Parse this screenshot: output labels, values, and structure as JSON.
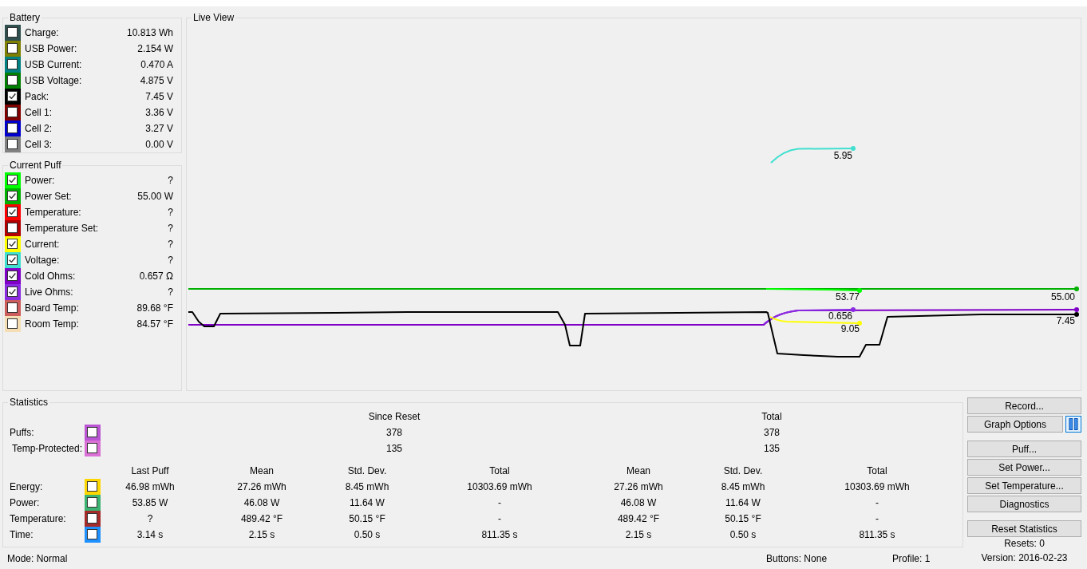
{
  "battery": {
    "title": "Battery",
    "rows": [
      {
        "label": "Charge:",
        "value": "10.813 Wh",
        "color": "#2f4f4f",
        "checked": false
      },
      {
        "label": "USB Power:",
        "value": "2.154 W",
        "color": "#808000",
        "checked": false
      },
      {
        "label": "USB Current:",
        "value": "0.470 A",
        "color": "#008080",
        "checked": false
      },
      {
        "label": "USB Voltage:",
        "value": "4.875 V",
        "color": "#008000",
        "checked": false
      },
      {
        "label": "Pack:",
        "value": "7.45 V",
        "color": "#000000",
        "checked": true
      },
      {
        "label": "Cell 1:",
        "value": "3.36 V",
        "color": "#800000",
        "checked": false
      },
      {
        "label": "Cell 2:",
        "value": "3.27 V",
        "color": "#0000cd",
        "checked": false
      },
      {
        "label": "Cell 3:",
        "value": "0.00 V",
        "color": "#808080",
        "checked": false
      }
    ]
  },
  "current_puff": {
    "title": "Current Puff",
    "rows": [
      {
        "label": "Power:",
        "value": "?",
        "color": "#00ff00",
        "checked": true
      },
      {
        "label": "Power Set:",
        "value": "55.00 W",
        "color": "#00b000",
        "checked": true
      },
      {
        "label": "Temperature:",
        "value": "?",
        "color": "#ff0000",
        "checked": true
      },
      {
        "label": "Temperature Set:",
        "value": "?",
        "color": "#b00000",
        "checked": false
      },
      {
        "label": "Current:",
        "value": "?",
        "color": "#ffff00",
        "checked": true
      },
      {
        "label": "Voltage:",
        "value": "?",
        "color": "#40e0d0",
        "checked": true
      },
      {
        "label": "Cold Ohms:",
        "value": "0.657 Ω",
        "color": "#8000c8",
        "checked": true
      },
      {
        "label": "Live Ohms:",
        "value": "?",
        "color": "#8a2be2",
        "checked": true
      },
      {
        "label": "Board Temp:",
        "value": "89.68 °F",
        "color": "#cd5c5c",
        "checked": false
      },
      {
        "label": "Room Temp:",
        "value": "84.57 °F",
        "color": "#f5deb3",
        "checked": false
      }
    ]
  },
  "live_view": {
    "title": "Live View",
    "traces": [
      {
        "color": "#40e0d0",
        "label": "5.95"
      },
      {
        "color": "#00ff00",
        "label": "53.77"
      },
      {
        "color": "#00b000",
        "label": "55.00"
      },
      {
        "color": "#8a2be2",
        "label": "0.656"
      },
      {
        "color": "#8000c8"
      },
      {
        "color": "#000000",
        "label": "7.45"
      },
      {
        "color": "#ffff00",
        "label": "9.05"
      }
    ]
  },
  "statistics": {
    "title": "Statistics",
    "count_columns": [
      "Since Reset",
      "Total"
    ],
    "count_rows": [
      {
        "label": "Puffs:",
        "color": "#ba55d3",
        "checked": false,
        "values": [
          "378",
          "378"
        ]
      },
      {
        "label": "Temp-Protected:",
        "color": "#da70d6",
        "checked": false,
        "values": [
          "135",
          "135"
        ]
      }
    ],
    "columns": [
      "Last Puff",
      "Mean",
      "Std. Dev.",
      "Total",
      "Mean",
      "Std. Dev.",
      "Total"
    ],
    "rows": [
      {
        "label": "Energy:",
        "color": "#ffd700",
        "checked": false,
        "values": [
          "46.98 mWh",
          "27.26 mWh",
          "8.45 mWh",
          "10303.69 mWh",
          "27.26 mWh",
          "8.45 mWh",
          "10303.69 mWh"
        ]
      },
      {
        "label": "Power:",
        "color": "#3cb371",
        "checked": false,
        "values": [
          "53.85 W",
          "46.08 W",
          "11.64 W",
          "-",
          "46.08 W",
          "11.64 W",
          "-"
        ]
      },
      {
        "label": "Temperature:",
        "color": "#a52a2a",
        "checked": false,
        "values": [
          "?",
          "489.42 °F",
          "50.15 °F",
          "-",
          "489.42 °F",
          "50.15 °F",
          "-"
        ]
      },
      {
        "label": "Time:",
        "color": "#1e90ff",
        "checked": false,
        "values": [
          "3.14 s",
          "2.15 s",
          "0.50 s",
          "811.35 s",
          "2.15 s",
          "0.50 s",
          "811.35 s"
        ]
      }
    ]
  },
  "action_groups": [
    [
      "Record...",
      "Graph Options"
    ],
    [
      "Puff...",
      "Set Power...",
      "Set Temperature...",
      "Diagnostics"
    ],
    [
      "Reset Statistics"
    ]
  ],
  "resets": "Resets: 0",
  "status_bar": {
    "mode": "Mode: Normal",
    "buttons": "Buttons: None",
    "profile": "Profile: 1",
    "version": "Version: 2016-02-23"
  }
}
